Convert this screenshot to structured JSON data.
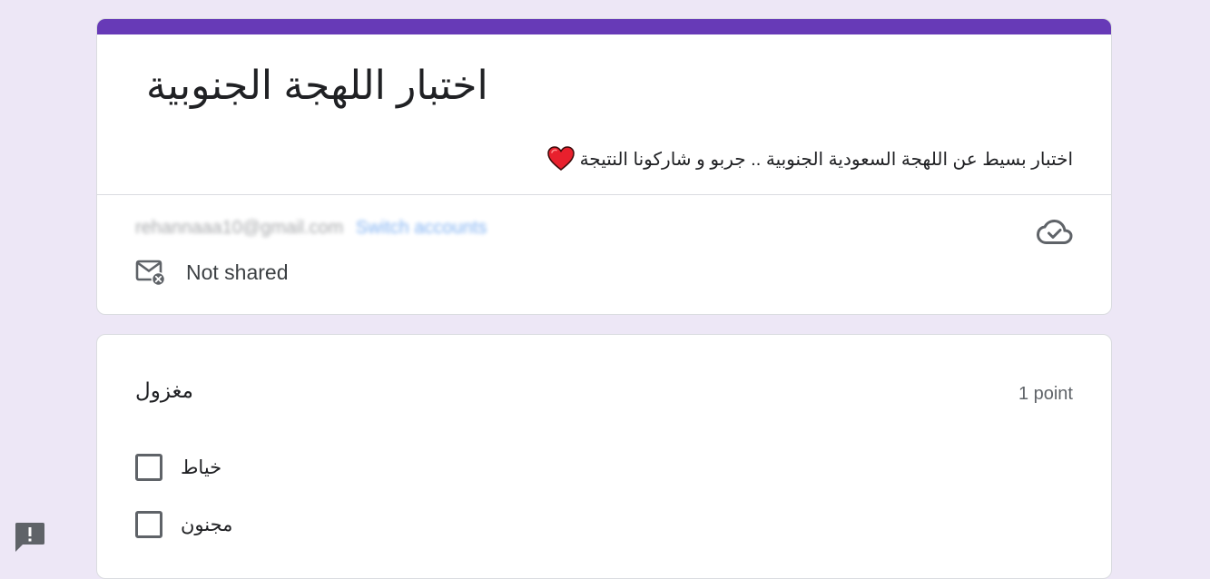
{
  "colors": {
    "page_background": "#ede7f6",
    "accent": "#673ab7",
    "checkbox_border": "#5f6368"
  },
  "form": {
    "title": "اختبار اللهجة الجنوبية",
    "description": "اختبار بسيط عن اللهجة السعودية الجنوبية .. جربو و شاركونا النتيجة",
    "description_emoji": "heart-icon",
    "account_email": "rehannaaa10@gmail.com",
    "switch_accounts": "Switch accounts",
    "not_shared": "Not shared",
    "icons": [
      "cloud-done-icon",
      "mail-not-shared-icon"
    ]
  },
  "question": {
    "title": "مغزول",
    "points": "1 point",
    "options": [
      {
        "label": "خياط",
        "checked": false
      },
      {
        "label": "مجنون",
        "checked": false
      }
    ]
  },
  "feedback": {
    "icon": "report-feedback-icon"
  }
}
